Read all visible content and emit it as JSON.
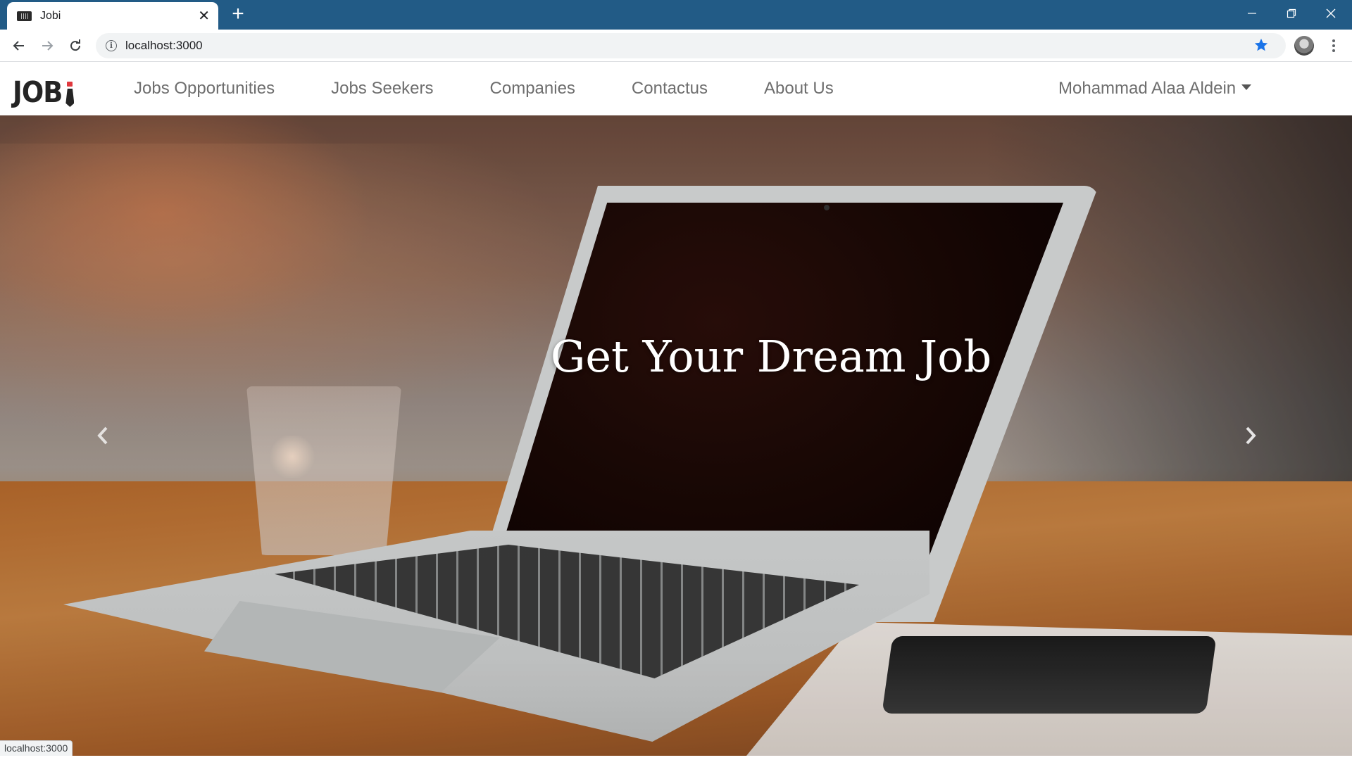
{
  "browser": {
    "tab_title": "Jobi",
    "new_tab": "+",
    "url": "localhost:3000",
    "status_url": "localhost:3000",
    "accent": "#225b86",
    "star_color": "#1a73e8",
    "icons": [
      "back-arrow-icon",
      "forward-arrow-icon",
      "reload-icon",
      "info-icon",
      "star-icon",
      "profile-avatar",
      "more-vert-icon",
      "minimize-icon",
      "restore-icon",
      "close-icon"
    ]
  },
  "site": {
    "logo": "JOB",
    "logo_accent": "#e0383e",
    "nav": [
      {
        "label": "Jobs Opportunities"
      },
      {
        "label": "Jobs Seekers"
      },
      {
        "label": "Companies"
      },
      {
        "label": "Contactus"
      },
      {
        "label": "About Us"
      }
    ],
    "user_name": "Mohammad Alaa Aldein"
  },
  "hero": {
    "caption": "Get Your Dream Job",
    "controls": [
      "chevron-left-icon",
      "chevron-right-icon"
    ]
  }
}
